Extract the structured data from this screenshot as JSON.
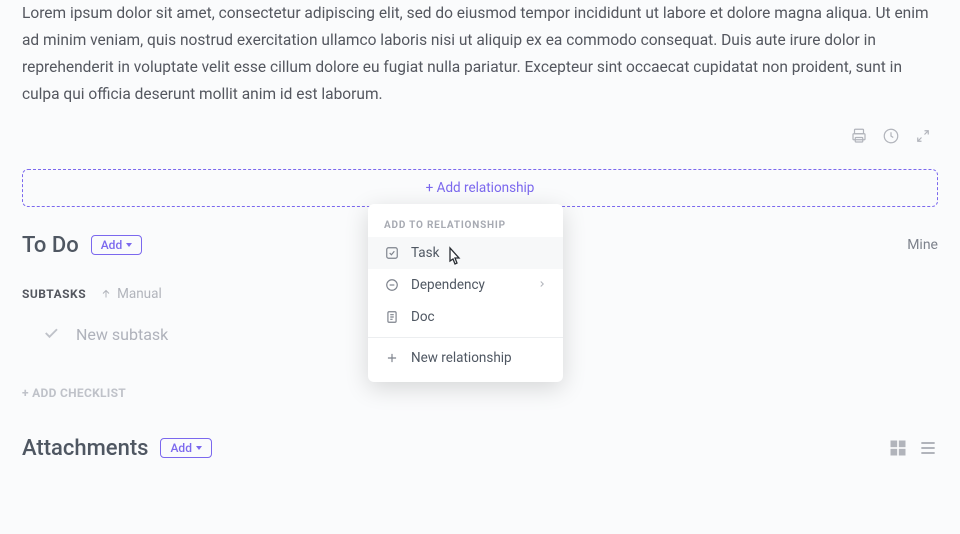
{
  "description": "Lorem ipsum dolor sit amet, consectetur adipiscing elit, sed do eiusmod tempor incididunt ut labore et dolore magna aliqua. Ut enim ad minim veniam, quis nostrud exercitation ullamco laboris nisi ut aliquip ex ea commodo consequat. Duis aute irure dolor in reprehenderit in voluptate velit esse cillum dolore eu fugiat nulla pariatur. Excepteur sint occaecat cupidatat non proident, sunt in culpa qui officia deserunt mollit anim id est laborum.",
  "relationship": {
    "add_label": "+ Add relationship",
    "popover_title": "ADD TO RELATIONSHIP",
    "items": [
      {
        "label": "Task"
      },
      {
        "label": "Dependency"
      },
      {
        "label": "Doc"
      }
    ],
    "new_label": "New relationship"
  },
  "todo": {
    "title": "To Do",
    "add_label": "Add",
    "mine_label": "Mine"
  },
  "subtasks": {
    "header": "SUBTASKS",
    "sort_label": "Manual",
    "placeholder": "New subtask"
  },
  "checklist": {
    "add_label": "+ ADD CHECKLIST"
  },
  "attachments": {
    "title": "Attachments",
    "add_label": "Add"
  }
}
